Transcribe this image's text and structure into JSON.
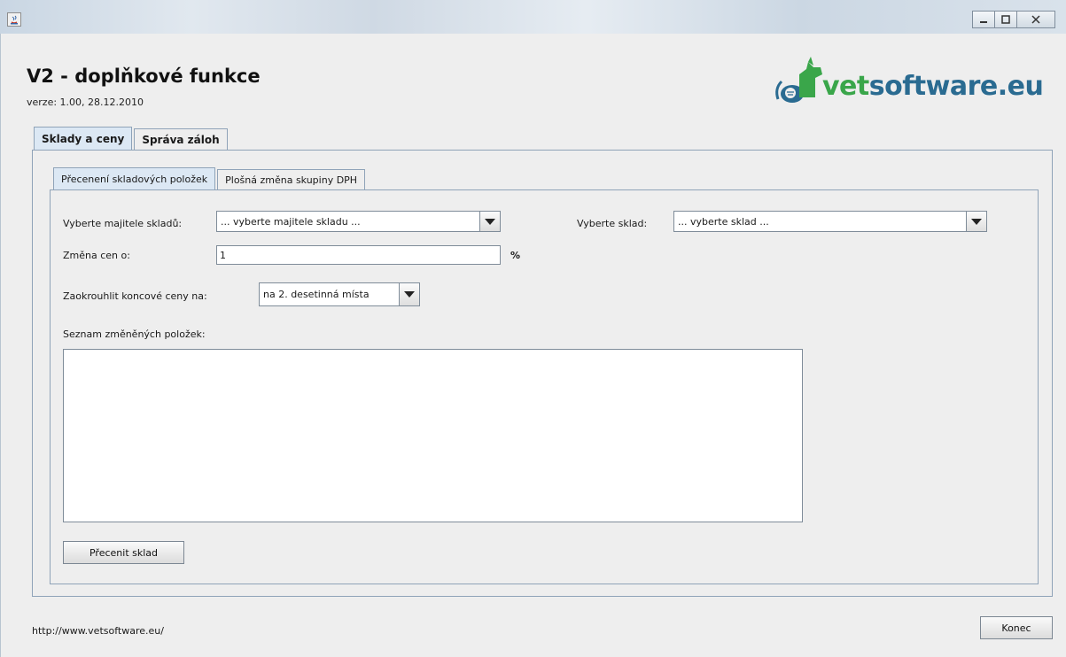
{
  "window": {
    "controls": [
      "minimize-icon",
      "maximize-icon",
      "close-icon"
    ]
  },
  "header": {
    "title": "V2 - doplňkové funkce",
    "version": "verze: 1.00, 28.12.2010",
    "logo_text_vet": "vet",
    "logo_text_rest": "software.eu"
  },
  "tabs_outer": [
    {
      "label": "Sklady a ceny",
      "active": true
    },
    {
      "label": "Správa záloh",
      "active": false
    }
  ],
  "tabs_inner": [
    {
      "label": "Přecenení skladových položek",
      "active": true
    },
    {
      "label": "Plošná změna skupiny DPH",
      "active": false
    }
  ],
  "form": {
    "owner_label": "Vyberte majitele skladů:",
    "owner_value": "... vyberte majitele skladu ...",
    "warehouse_label": "Vyberte sklad:",
    "warehouse_value": "... vyberte sklad ...",
    "price_change_label": "Změna cen o:",
    "price_change_value": "1",
    "percent_label": "%",
    "rounding_label": "Zaokrouhlit koncové ceny na:",
    "rounding_value": "na 2. desetinná místa",
    "list_label": "Seznam změněných položek:",
    "reprice_button": "Přecenit sklad"
  },
  "footer": {
    "url": "http://www.vetsoftware.eu/",
    "close_button": "Konec"
  },
  "colors": {
    "logo_blue": "#2a6b91",
    "logo_green": "#3aa64a",
    "tab_active": "#dce8f4",
    "panel_border": "#8fa3b8"
  }
}
